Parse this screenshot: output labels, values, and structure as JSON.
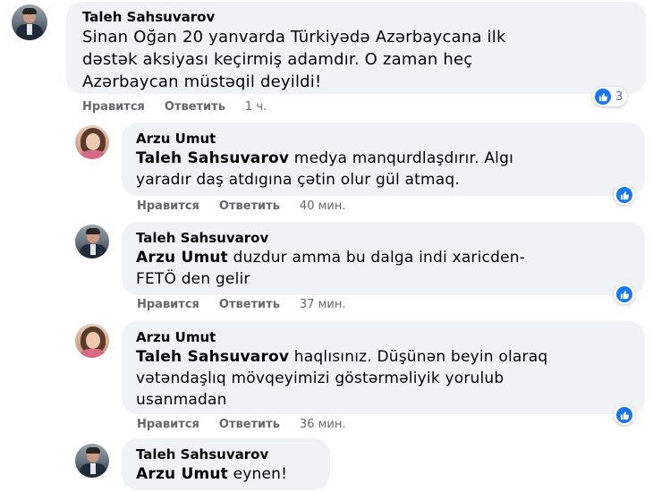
{
  "comments": [
    {
      "author": "Taleh Sahsuvarov",
      "lines": [
        "Sinan Oğan 20 yanvarda Türkiyədə Azərbaycana ilk",
        "dəstək aksiyası keçirmiş adamdır. O zaman heç",
        "Azərbaycan müstəqil deyildi!"
      ],
      "actions": {
        "like": "Нравится",
        "reply": "Ответить",
        "time": "1 ч."
      },
      "like_count": "3"
    },
    {
      "author": "Arzu Umut",
      "mention": "Taleh Sahsuvarov",
      "lines": [
        " medya manqurdlaşdırır. Algı",
        "yaradır daş atdıgına çətin olur gül atmaq."
      ],
      "actions": {
        "like": "Нравится",
        "reply": "Ответить",
        "time": "40 мин."
      }
    },
    {
      "author": "Taleh Sahsuvarov",
      "mention": "Arzu Umut",
      "lines": [
        " duzdur amma bu dalga indi xaricden-",
        "FETÖ den gelir"
      ],
      "actions": {
        "like": "Нравится",
        "reply": "Ответить",
        "time": "37 мин."
      }
    },
    {
      "author": "Arzu Umut",
      "mention": "Taleh Sahsuvarov",
      "lines": [
        " haqlısınız. Düşünən beyin olaraq",
        "vətəndaşlıq mövqeyimizi göstərməliyik yorulub",
        "usanmadan"
      ],
      "actions": {
        "like": "Нравится",
        "reply": "Ответить",
        "time": "36 мин."
      }
    },
    {
      "author": "Taleh Sahsuvarov",
      "mention": "Arzu Umut",
      "lines": [
        " eynen!"
      ]
    }
  ],
  "colors": {
    "bubble": "#f0f2f5",
    "like_blue": "#1877f2",
    "meta_gray": "#65676b"
  },
  "icons": {
    "like": "thumbs-up-icon"
  }
}
